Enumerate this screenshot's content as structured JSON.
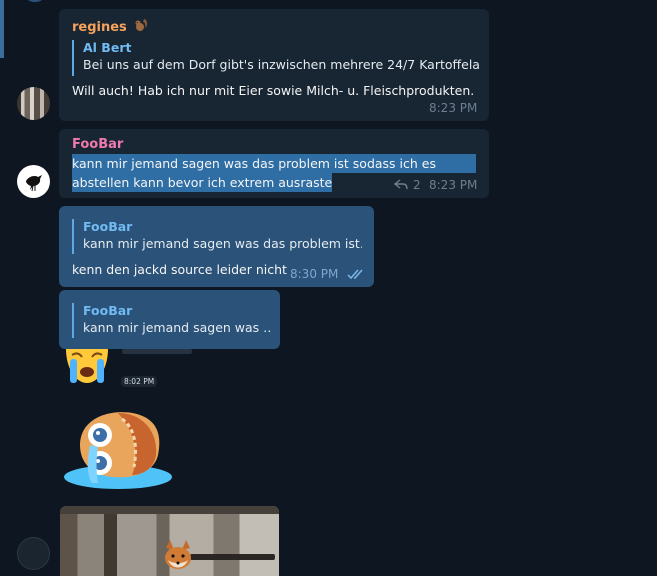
{
  "messages": [
    {
      "sender": "regines",
      "sender_color": "#f5a35c",
      "reply_to": {
        "name": "Al Bert",
        "text": "Bei uns auf dem Dorf gibt's inzwischen mehrere 24/7 Kartoffela…"
      },
      "text": "Will auch! Hab ich nur mit Eier sowie Milch- u. Fleischprodukten.",
      "time": "8:23 PM"
    },
    {
      "sender": "FooBar",
      "sender_color": "#ee7aae",
      "text_lines": [
        "kann mir jemand sagen was das problem ist sodass ich es",
        "abstellen kann bevor ich extrem ausraste"
      ],
      "reply_count": "2",
      "time": "8:23 PM"
    },
    {
      "outgoing": true,
      "reply_to": {
        "name": "FooBar",
        "text": "kann mir jemand sagen was das problem ist…"
      },
      "text": "kenn den jackd source leider nicht",
      "time": "8:30 PM"
    },
    {
      "outgoing": true,
      "reply_to": {
        "name": "FooBar",
        "text": "kann mir jemand sagen was …"
      },
      "sticker_time": "8:02 PM"
    }
  ],
  "colors": {
    "background": "#0e1621",
    "incoming_bubble": "#182533",
    "outgoing_bubble": "#2b5278",
    "accent": "#5ea8e6",
    "selection": "#2f6ea5"
  },
  "icons": [
    "squirrel-emoji-icon",
    "reply-arrow-icon",
    "double-check-icon",
    "crying-emoji-sticker",
    "crying-sandwich-sticker"
  ]
}
